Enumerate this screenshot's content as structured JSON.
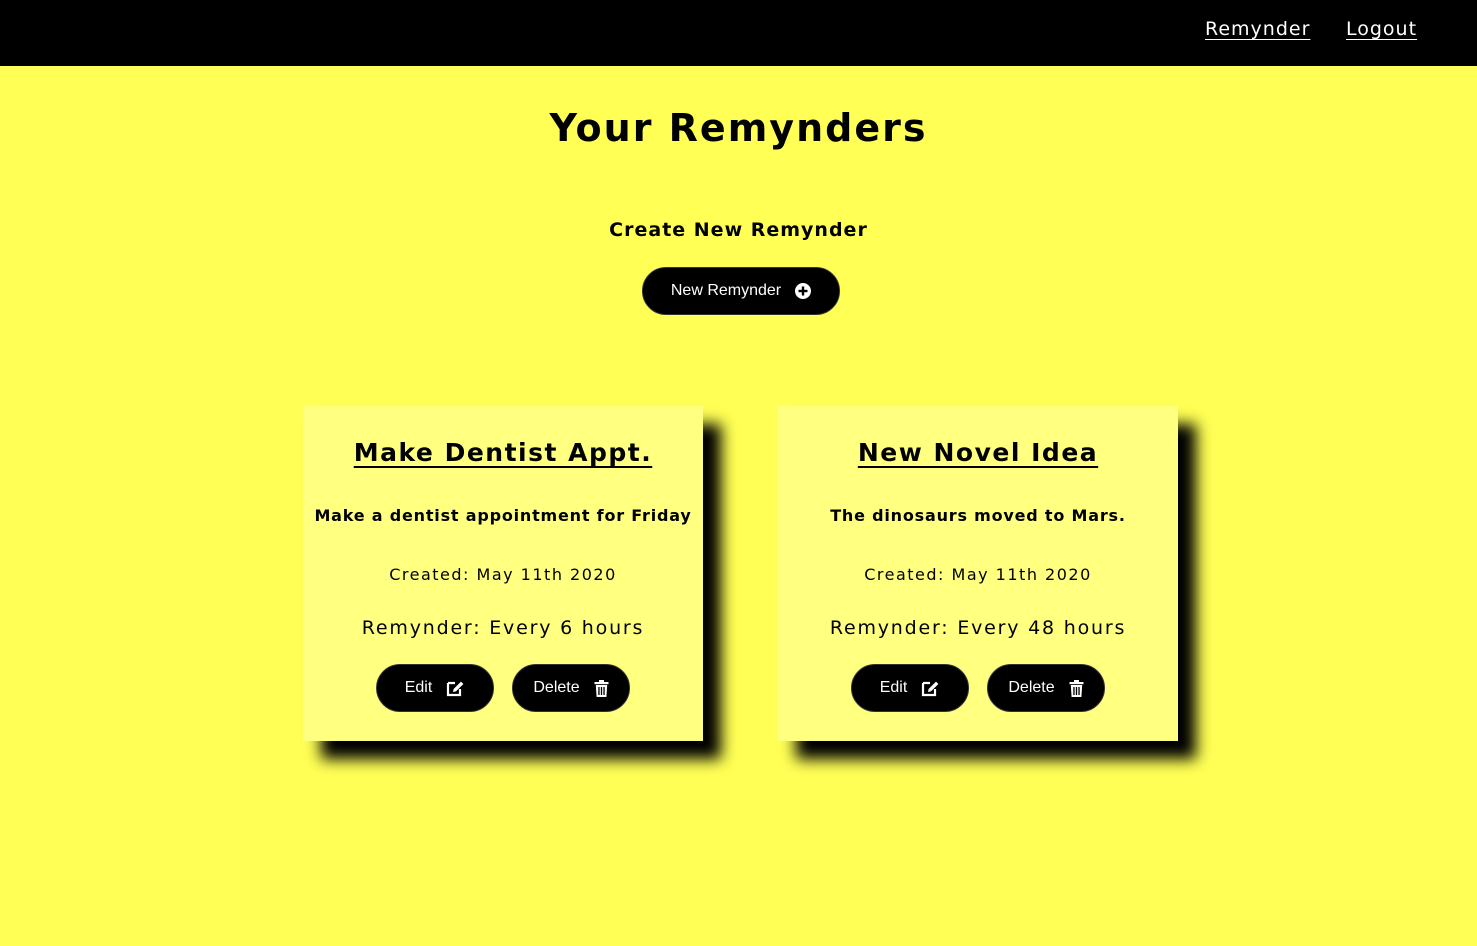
{
  "nav": {
    "brand": "Remynder",
    "logout": "Logout"
  },
  "page": {
    "title": "Your Remynders",
    "create_label": "Create New Remynder",
    "new_button": "New Remynder"
  },
  "icons": {
    "new": "plus-circle-icon",
    "edit": "edit-icon",
    "delete": "trash-icon"
  },
  "colors": {
    "background": "#ffff56",
    "card": "#ffff80",
    "navbar": "#000000",
    "button": "#000000"
  },
  "cards": [
    {
      "title": "Make Dentist Appt.",
      "body": "Make a dentist appointment for Friday",
      "created": "Created: May 11th 2020",
      "interval": "Remynder: Every 6 hours",
      "edit_label": "Edit",
      "delete_label": "Delete"
    },
    {
      "title": "New Novel Idea",
      "body": "The dinosaurs moved to Mars.",
      "created": "Created: May 11th 2020",
      "interval": "Remynder: Every 48 hours",
      "edit_label": "Edit",
      "delete_label": "Delete"
    }
  ]
}
